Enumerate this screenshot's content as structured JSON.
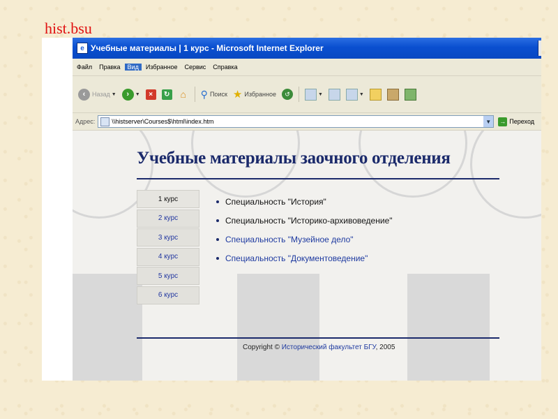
{
  "slide": {
    "title": "hist.bsu"
  },
  "window": {
    "title": "Учебные материалы | 1 курс - Microsoft Internet Explorer",
    "icon_letter": "e"
  },
  "menu": [
    "Файл",
    "Правка",
    "Вид",
    "Избранное",
    "Сервис",
    "Справка"
  ],
  "menu_active_index": 2,
  "toolbar": {
    "back_label": "Назад",
    "search_label": "Поиск",
    "favorites_label": "Избранное"
  },
  "address": {
    "label": "Адрес:",
    "url": "\\\\histserver\\Courses$\\html\\index.htm",
    "go_label": "Переход"
  },
  "page": {
    "heading": "Учебные материалы заочного отделения",
    "courses": [
      "1 курс",
      "2 курс",
      "3 курс",
      "4 курс",
      "5 курс",
      "6 курс"
    ],
    "active_course_index": 0,
    "specialties": [
      "Специальность \"История\"",
      "Специальность \"Историко-архивоведение\"",
      "Специальность \"Музейное дело\"",
      "Специальность \"Документоведение\""
    ],
    "copyright_prefix": "Copyright ©",
    "copyright_link": "Исторический факультет БГУ",
    "copyright_suffix": ", 2005"
  },
  "colors": {
    "slide_title": "#e01010",
    "heading": "#1b2a6b",
    "link": "#1e3aa0",
    "titlebar": "#0a4fd0"
  }
}
